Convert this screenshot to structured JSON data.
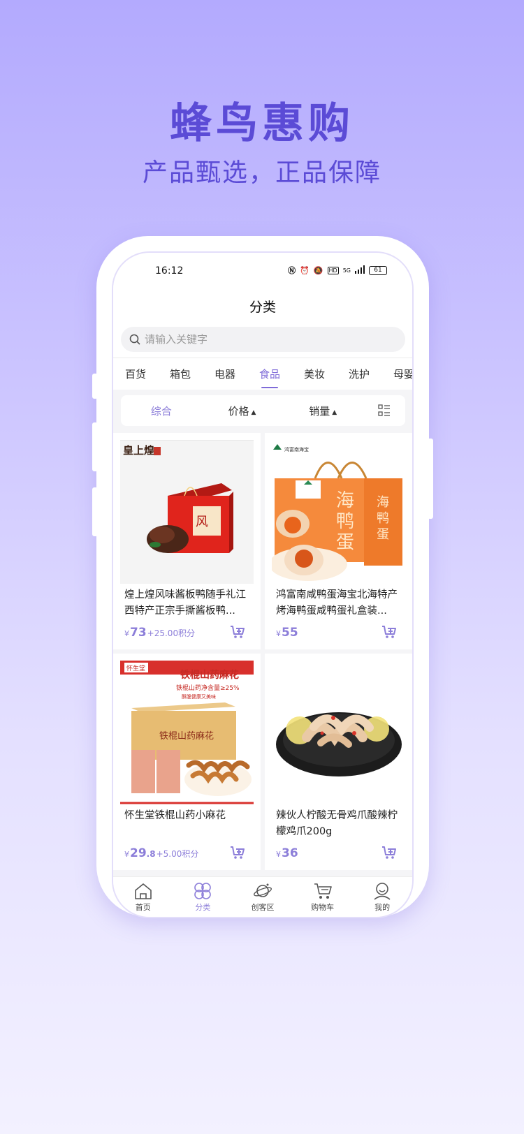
{
  "promo": {
    "title": "蜂鸟惠购",
    "subtitle": "产品甄选，正品保障"
  },
  "status_bar": {
    "time": "16:12",
    "network": "5G",
    "battery": "61"
  },
  "header": {
    "title": "分类"
  },
  "search": {
    "placeholder": "请输入关键字"
  },
  "category_tabs": [
    {
      "label": "百货",
      "active": false
    },
    {
      "label": "箱包",
      "active": false
    },
    {
      "label": "电器",
      "active": false
    },
    {
      "label": "食品",
      "active": true
    },
    {
      "label": "美妆",
      "active": false
    },
    {
      "label": "洗护",
      "active": false
    },
    {
      "label": "母婴",
      "active": false
    }
  ],
  "filters": {
    "comprehensive": "综合",
    "price": "价格",
    "sales": "销量"
  },
  "products": [
    {
      "name": "煌上煌风味酱板鸭随手礼江西特产正宗手撕酱板鸭...",
      "brand_text": "皇上煌",
      "price_symbol": "¥",
      "price": "73",
      "price_decimal": "",
      "points": "+25.00积分"
    },
    {
      "name": "鸿富南咸鸭蛋海宝北海特产烤海鸭蛋咸鸭蛋礼盒装...",
      "brand_text": "鸿富南海宝",
      "package_text": "海鸭蛋",
      "price_symbol": "¥",
      "price": "55",
      "price_decimal": "",
      "points": ""
    },
    {
      "name": "怀生堂铁棍山药小麻花",
      "brand_text": "怀生堂",
      "banner_text": "铁棍山药麻花",
      "banner_sub": "铁棍山药净含量≥25%",
      "banner_sub2": "酥脆健康又美味",
      "price_symbol": "¥",
      "price": "29",
      "price_decimal": ".8",
      "points": "+5.00积分"
    },
    {
      "name": "辣伙人柠酸无骨鸡爪酸辣柠檬鸡爪200g",
      "price_symbol": "¥",
      "price": "36",
      "price_decimal": "",
      "points": ""
    }
  ],
  "tabbar": [
    {
      "label": "首页",
      "icon": "home-icon",
      "active": false
    },
    {
      "label": "分类",
      "icon": "category-icon",
      "active": true
    },
    {
      "label": "创客区",
      "icon": "planet-icon",
      "active": false
    },
    {
      "label": "购物车",
      "icon": "cart-icon",
      "active": false
    },
    {
      "label": "我的",
      "icon": "user-icon",
      "active": false
    }
  ],
  "colors": {
    "accent": "#8c7ed9",
    "promo_text": "#5b4bd6",
    "background_top": "#b3aafe"
  }
}
